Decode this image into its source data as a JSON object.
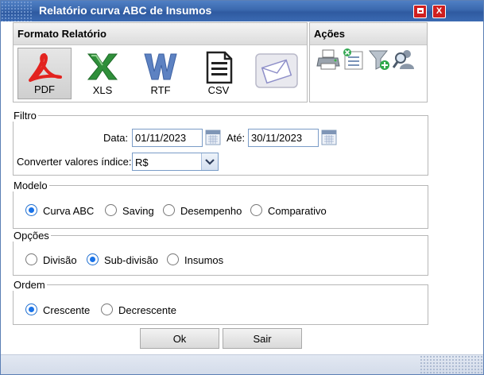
{
  "window": {
    "title": "Relatório curva ABC de Insumos",
    "close_label": "X"
  },
  "formato": {
    "header": "Formato Relatório",
    "buttons": [
      {
        "label": "PDF",
        "icon": "pdf-icon",
        "selected": true
      },
      {
        "label": "XLS",
        "icon": "excel-icon",
        "selected": false
      },
      {
        "label": "RTF",
        "icon": "word-icon",
        "selected": false
      },
      {
        "label": "CSV",
        "icon": "csv-document-icon",
        "selected": false
      },
      {
        "label": "",
        "icon": "email-envelope-icon",
        "selected": false
      }
    ]
  },
  "acoes": {
    "header": "Ações",
    "icons": [
      "printer-icon",
      "clear-list-icon",
      "add-filter-icon",
      "search-user-icon"
    ]
  },
  "filtro": {
    "legend": "Filtro",
    "data_label": "Data:",
    "data_from": "01/11/2023",
    "ate_label": "Até:",
    "data_to": "30/11/2023",
    "converter_label": "Converter valores índice:",
    "converter_value": "R$"
  },
  "modelo": {
    "legend": "Modelo",
    "options": [
      {
        "label": "Curva ABC",
        "checked": true
      },
      {
        "label": "Saving",
        "checked": false
      },
      {
        "label": "Desempenho",
        "checked": false
      },
      {
        "label": "Comparativo",
        "checked": false
      }
    ]
  },
  "opcoes": {
    "legend": "Opções",
    "options": [
      {
        "label": "Divisão",
        "checked": false
      },
      {
        "label": "Sub-divisão",
        "checked": true
      },
      {
        "label": "Insumos",
        "checked": false
      }
    ]
  },
  "ordem": {
    "legend": "Ordem",
    "options": [
      {
        "label": "Crescente",
        "checked": true
      },
      {
        "label": "Decrescente",
        "checked": false
      }
    ]
  },
  "footer": {
    "ok_label": "Ok",
    "sair_label": "Sair"
  }
}
